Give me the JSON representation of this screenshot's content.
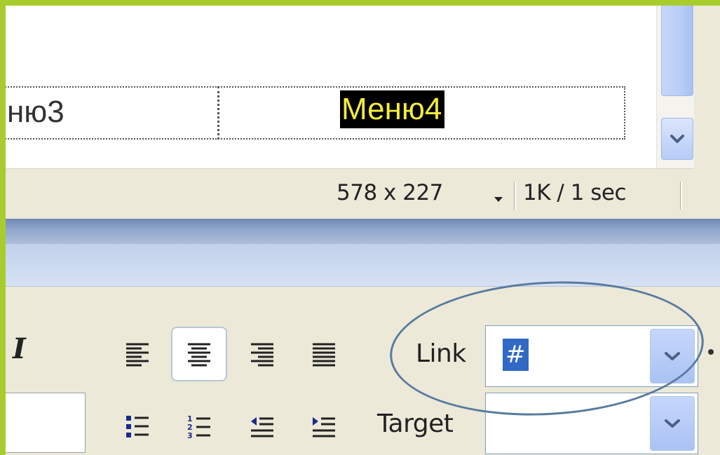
{
  "design_view": {
    "menu_items": [
      "ню3",
      "Меню4"
    ]
  },
  "status_bar": {
    "window_size": "578 x 227",
    "download_stats": "1K / 1 sec"
  },
  "properties": {
    "italic_label": "I",
    "link_label": "Link",
    "link_value": "#",
    "target_label": "Target",
    "target_value": ""
  },
  "icons": {
    "scroll_down": "chevron-down-icon",
    "size_dropdown": "triangle-down-icon",
    "combo_dropdown": "chevron-down-icon",
    "toolbar": [
      "align-left-icon",
      "align-center-icon",
      "align-right-icon",
      "align-justify-icon",
      "unordered-list-icon",
      "ordered-list-icon",
      "outdent-icon",
      "indent-icon"
    ]
  },
  "colors": {
    "outer_border": "#a8cc2c",
    "selection_bg": "#000000",
    "selection_text": "#f3ed3b",
    "panel_bg": "#ece9d8",
    "splitter": "#7b93bd",
    "highlight_ellipse": "#587ba0",
    "combo_selection": "#3169c6"
  }
}
